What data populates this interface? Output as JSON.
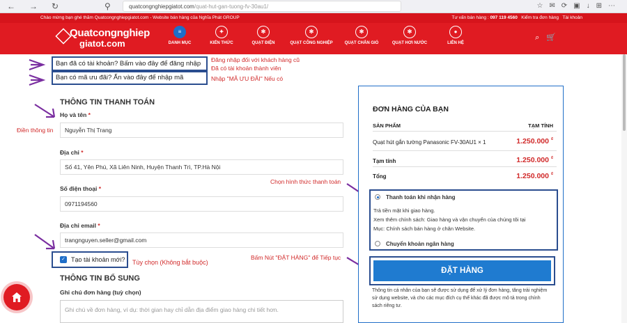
{
  "browser": {
    "url_domain": "quatcongnghiepgiatot.com",
    "url_path": "/quat-hut-gan-tuong-fv-30au1/"
  },
  "topbar": {
    "welcome": "Chào mừng bạn ghé thăm Quatcongnghiepgiatot.com - Website bán hàng của Nghĩa Phát GROUP",
    "hotline_label": "Tư vấn bán hàng :",
    "hotline": "097 119 4560",
    "order_check": "Kiểm tra đơn hàng",
    "account": "Tài khoản"
  },
  "logo": {
    "line1": "Quatcongnghiep",
    "line2": "giatot.com"
  },
  "menu": {
    "items": [
      {
        "label": "DANH MỤC",
        "icon": "hamburger-icon"
      },
      {
        "label": "KIẾN THỨC",
        "icon": "bulb-icon"
      },
      {
        "label": "QUẠT ĐIỆN",
        "icon": "fan-icon"
      },
      {
        "label": "QUẠT CÔNG NGHIỆP",
        "icon": "fan-icon"
      },
      {
        "label": "QUẠT CHẮN GIÓ",
        "icon": "fan-icon"
      },
      {
        "label": "QUẠT HƠI NƯỚC",
        "icon": "fan-icon"
      },
      {
        "label": "LIÊN HỆ",
        "icon": "location-icon"
      }
    ]
  },
  "login_prompt": "Bạn đã có tài khoản? Bấm vào đây để đăng nhập",
  "login_note1": "Đăng nhập đối với khách hàng cũ",
  "login_note2": "Đã có tài khoản thành viên",
  "coupon_prompt": "Bạn có mã ưu đãi? Ấn vào đây để nhập mã",
  "coupon_note": "Nhập \"MÃ ƯU ĐÃI\" Nếu có",
  "billing": {
    "title": "THÔNG TIN THANH TOÁN",
    "fill_note": "Điền thông tin",
    "name_label": "Họ và tên",
    "name_value": "Nguyễn Thị Trang",
    "address_label": "Địa chỉ",
    "address_value": "Số 41, Yên Phú, Xã Liên Ninh, Huyện Thanh Trì, TP.Hà Nội",
    "phone_label": "Số điện thoại",
    "phone_value": "0971194560",
    "email_label": "Địa chỉ email",
    "email_value": "trangnguyen.seller@gmail.com",
    "required_mark": "*"
  },
  "create_account": {
    "label": "Tạo tài khoản mới?",
    "note": "Tùy chọn (Không bắt buộc)",
    "checked": true
  },
  "extra": {
    "title": "THÔNG TIN BỔ SUNG",
    "notes_label": "Ghi chú đơn hàng (tuỳ chọn)",
    "notes_placeholder": "Ghi chú về đơn hàng, ví dụ: thời gian hay chỉ dẫn địa điểm giao hàng chi tiết hơn."
  },
  "order": {
    "title": "ĐƠN HÀNG CỦA BẠN",
    "col_product": "SẢN PHẨM",
    "col_subtotal": "TẠM TÍNH",
    "item_name": "Quạt hút gắn tường Panasonic FV-30AU1",
    "item_qty": "× 1",
    "item_price": "1.250.000",
    "subtotal_label": "Tạm tính",
    "subtotal": "1.250.000",
    "total_label": "Tổng",
    "total": "1.250.000",
    "currency": "₫"
  },
  "payment": {
    "choose_note": "Chọn hình thức thanh toán",
    "cod_label": "Thanh toán khi nhận hàng",
    "cod_desc1": "Trả tiền mặt khi giao hàng.",
    "cod_desc2": "Xem thêm chính sách: Giao hàng và vận chuyển của chúng tôi tại",
    "cod_desc3": "Mục: Chính sách bán hàng ở chân Website.",
    "bank_label": "Chuyển khoản ngân hàng"
  },
  "place_order": {
    "note": "Bấm Nút \"ĐẶT HÀNG\" để Tiếp tục",
    "button": "ĐẶT HÀNG"
  },
  "privacy_note": "Thông tin cá nhân của bạn sẽ được sử dụng để xử lý đơn hàng, tăng trải nghiệm sử dụng website, và cho các mục đích cụ thể khác đã được mô tả trong chính sách riêng tư.",
  "colors": {
    "brand_red": "#e01b22",
    "accent_blue": "#1f7bd0",
    "annotation_red": "#d12a2a"
  }
}
